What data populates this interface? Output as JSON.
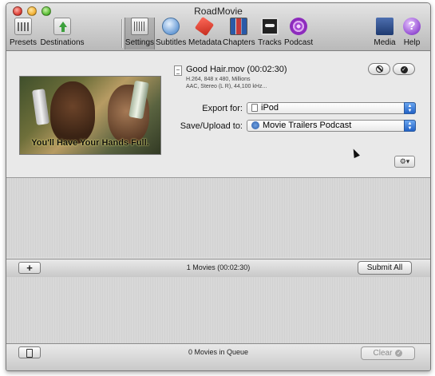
{
  "window": {
    "title": "RoadMovie"
  },
  "toolbar": {
    "left": [
      {
        "label": "Presets",
        "icon": "presets-icon"
      },
      {
        "label": "Destinations",
        "icon": "destinations-icon"
      }
    ],
    "tabs": [
      {
        "label": "Settings",
        "icon": "settings-icon",
        "active": true
      },
      {
        "label": "Subtitles",
        "icon": "subtitles-icon"
      },
      {
        "label": "Metadata",
        "icon": "metadata-icon"
      },
      {
        "label": "Chapters",
        "icon": "chapters-icon"
      },
      {
        "label": "Tracks",
        "icon": "tracks-icon"
      },
      {
        "label": "Podcast",
        "icon": "podcast-icon"
      }
    ],
    "right": [
      {
        "label": "Media",
        "icon": "media-icon"
      },
      {
        "label": "Help",
        "icon": "help-icon"
      }
    ]
  },
  "movie": {
    "title": "Good Hair.mov (00:02:30)",
    "info_line1": "H.264, 848 x 480, Millions",
    "info_line2": "AAC, Stereo (L R), 44,100 kHz...",
    "thumbnail_caption": "You'll Have Your Hands Full."
  },
  "form": {
    "export_label": "Export for:",
    "export_value": "iPod",
    "save_label": "Save/Upload to:",
    "save_value": "Movie Trailers Podcast"
  },
  "icons": {
    "cancel": "cancel-icon",
    "confirm": "checkmark-icon",
    "gear": "gear-icon"
  },
  "status": {
    "add_label": "+",
    "movies_count": "1 Movies (00:02:30)",
    "submit_label": "Submit All",
    "queue_text": "0 Movies in Queue",
    "clear_label": "Clear"
  }
}
